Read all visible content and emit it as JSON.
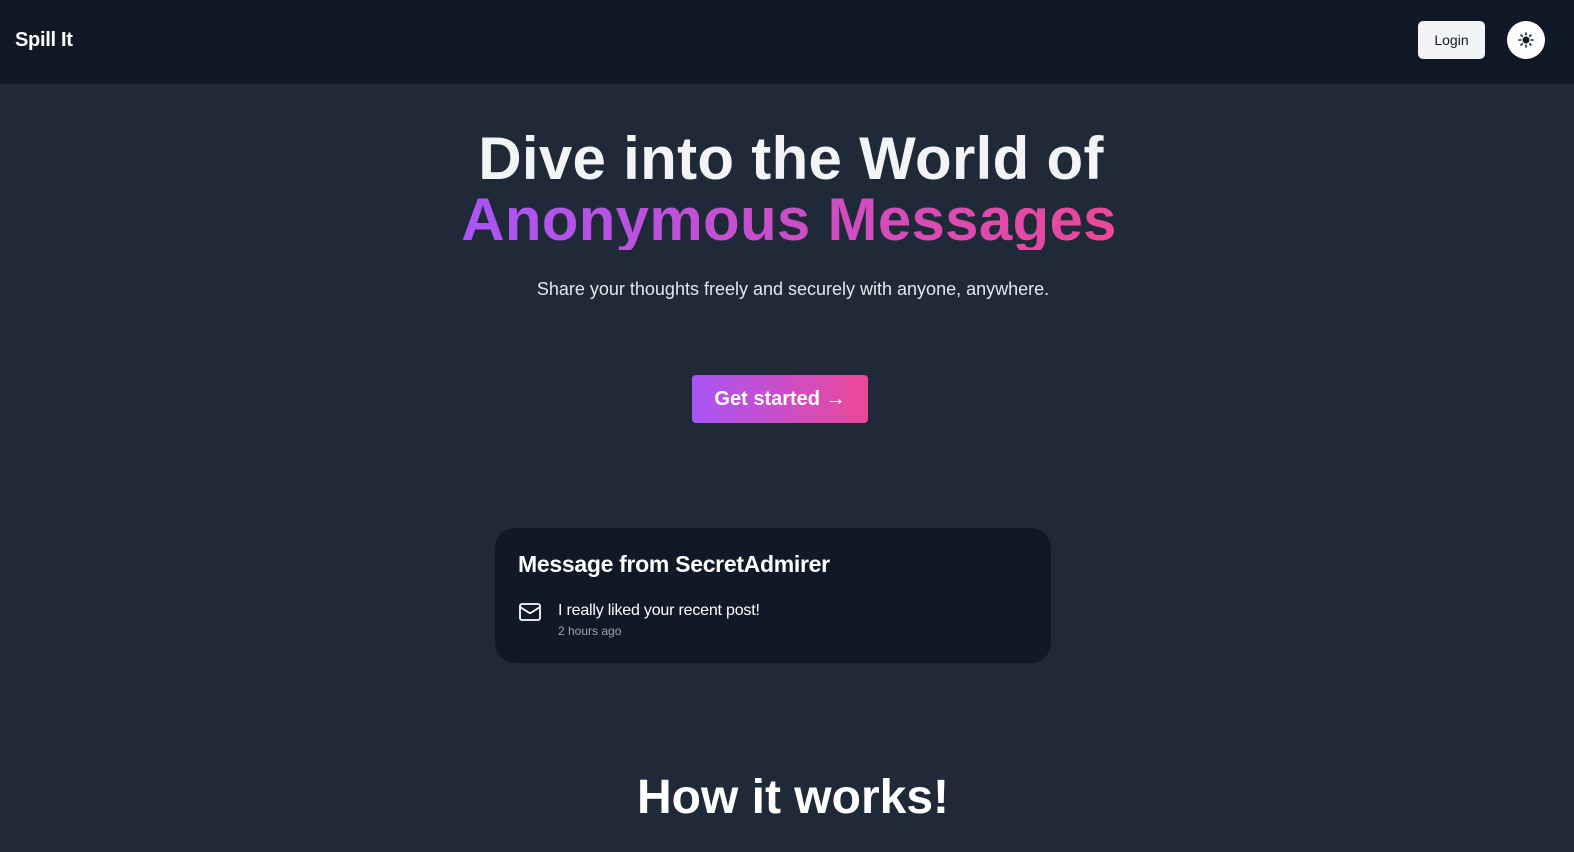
{
  "navbar": {
    "brand": "Spill It",
    "login_label": "Login",
    "theme_toggle_icon": "sun-icon"
  },
  "hero": {
    "title_line1": "Dive into the World of",
    "title_line2": "Anonymous Messages",
    "subtitle": "Share your thoughts freely and securely with anyone, anywhere.",
    "cta_label": "Get started →"
  },
  "message_card": {
    "title": "Message from SecretAdmirer",
    "icon": "mail-icon",
    "message": "I really liked your recent post!",
    "time": "2 hours ago"
  },
  "how_it_works": {
    "title": "How it works!"
  },
  "colors": {
    "page_bg": "#1f2937",
    "navbar_bg": "#111827",
    "card_bg": "#111827",
    "gradient_start": "#a855f7",
    "gradient_end": "#ec4899"
  }
}
